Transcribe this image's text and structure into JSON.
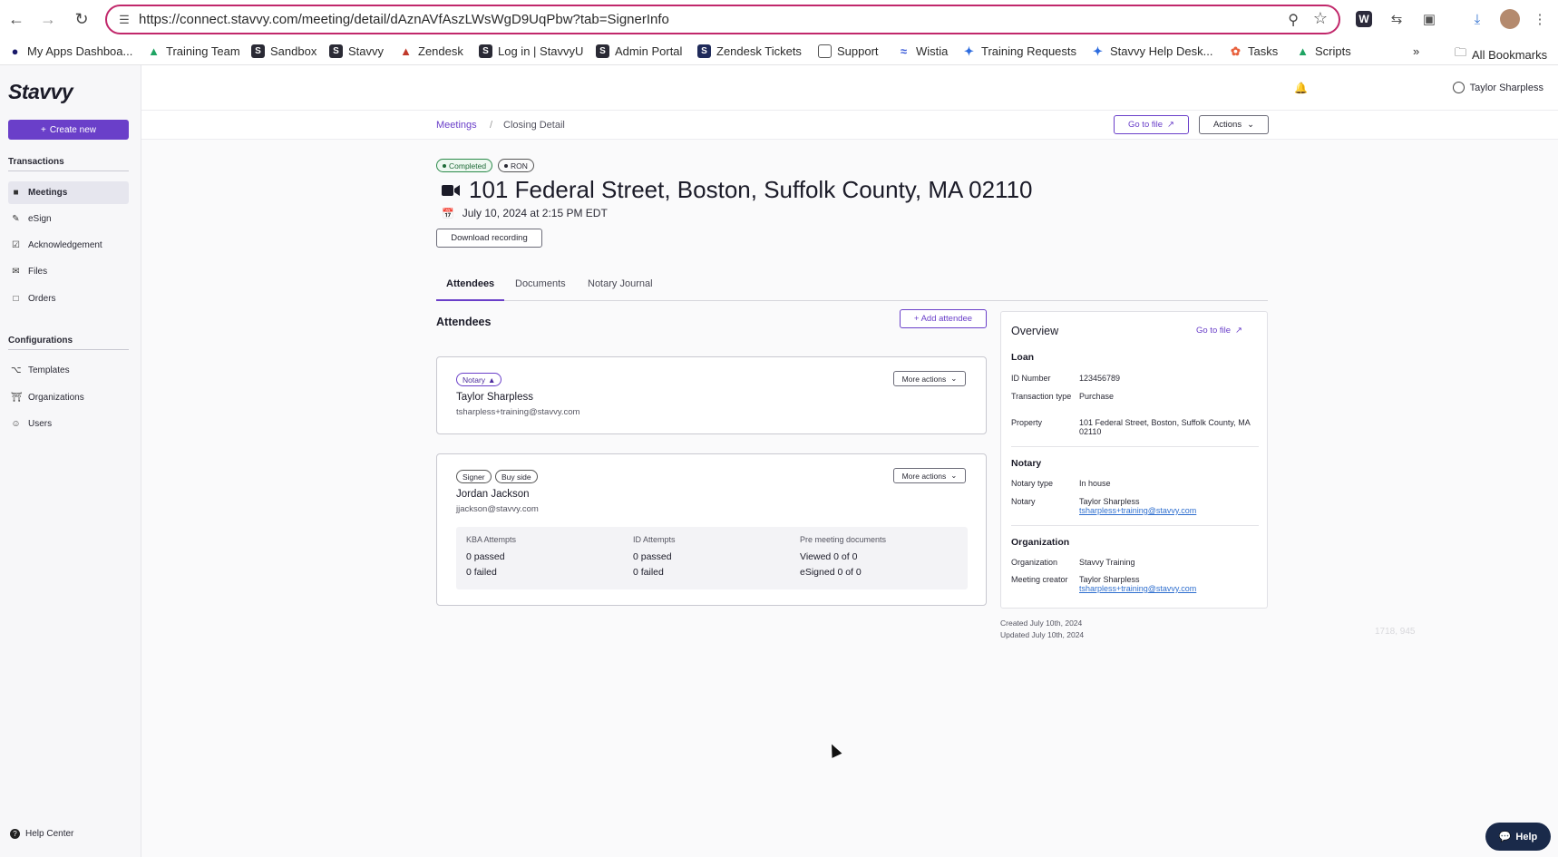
{
  "browser": {
    "url": "https://connect.stavvy.com/meeting/detail/dAznAVfAszLWsWgD9UqPbw?tab=SignerInfo",
    "bookmarks": [
      {
        "label": "My Apps Dashboa...",
        "icon": "okta-icon",
        "color": "#1a1a6a"
      },
      {
        "label": "Training Team",
        "icon": "drive-icon",
        "color": "#1fa463"
      },
      {
        "label": "Sandbox",
        "icon": "stavvy-s-icon",
        "color": "#2a2a35"
      },
      {
        "label": "Stavvy",
        "icon": "stavvy-s-icon",
        "color": "#2a2a35"
      },
      {
        "label": "Zendesk",
        "icon": "zendesk-icon",
        "color": "#c0392b"
      },
      {
        "label": "Log in | StavvyU",
        "icon": "stavvy-s-icon",
        "color": "#2a2a35"
      },
      {
        "label": "Admin Portal",
        "icon": "stavvy-s-icon",
        "color": "#2a2a35"
      },
      {
        "label": "Zendesk Tickets",
        "icon": "stavvy-s-icon",
        "color": "#1f2a5a"
      },
      {
        "label": "Support",
        "icon": "folder-icon",
        "color": "#555"
      },
      {
        "label": "Wistia",
        "icon": "wistia-icon",
        "color": "#3a5bd9"
      },
      {
        "label": "Training Requests",
        "icon": "jira-icon",
        "color": "#2d6cdf"
      },
      {
        "label": "Stavvy Help Desk...",
        "icon": "jira-icon",
        "color": "#2d6cdf"
      },
      {
        "label": "Tasks",
        "icon": "hubspot-icon",
        "color": "#e8603c"
      },
      {
        "label": "Scripts",
        "icon": "drive-icon",
        "color": "#1fa463"
      }
    ],
    "all_bookmarks": "All Bookmarks"
  },
  "sidebar": {
    "logo": "Stavvy",
    "create_new": "Create new",
    "transactions_label": "Transactions",
    "transactions": [
      {
        "label": "Meetings",
        "icon": "video-icon",
        "active": true
      },
      {
        "label": "eSign",
        "icon": "esign-icon",
        "active": false
      },
      {
        "label": "Acknowledgement",
        "icon": "checkbox-icon",
        "active": false
      },
      {
        "label": "Files",
        "icon": "mail-icon",
        "active": false
      },
      {
        "label": "Orders",
        "icon": "document-icon",
        "active": false
      }
    ],
    "configurations_label": "Configurations",
    "configurations": [
      {
        "label": "Templates",
        "icon": "template-icon"
      },
      {
        "label": "Organizations",
        "icon": "bank-icon"
      },
      {
        "label": "Users",
        "icon": "users-icon"
      }
    ],
    "help_center": "Help Center"
  },
  "header": {
    "user_name": "Taylor Sharpless"
  },
  "breadcrumb": {
    "parent": "Meetings",
    "separator": "/",
    "current": "Closing Detail"
  },
  "toolbar": {
    "go_to_file": "Go to file",
    "actions": "Actions"
  },
  "meeting": {
    "status_badge": "Completed",
    "type_badge": "RON",
    "title": "101 Federal Street, Boston, Suffolk County, MA 02110",
    "date": "July 10, 2024 at 2:15 PM EDT",
    "download_recording": "Download recording"
  },
  "tabs": [
    {
      "label": "Attendees",
      "active": true
    },
    {
      "label": "Documents",
      "active": false
    },
    {
      "label": "Notary Journal",
      "active": false
    }
  ],
  "attendees": {
    "title": "Attendees",
    "add_attendee": "+ Add attendee",
    "more_actions": "More actions",
    "notary": {
      "role": "Notary",
      "name": "Taylor Sharpless",
      "email": "tsharpless+training@stavvy.com"
    },
    "signer": {
      "role": "Signer",
      "side": "Buy side",
      "name": "Jordan Jackson",
      "email": "jjackson@stavvy.com",
      "stats": [
        {
          "heading": "KBA Attempts",
          "line1": "0 passed",
          "line2": "0 failed"
        },
        {
          "heading": "ID Attempts",
          "line1": "0 passed",
          "line2": "0 failed"
        },
        {
          "heading": "Pre meeting documents",
          "line1": "Viewed 0 of 0",
          "line2": "eSigned 0 of 0"
        }
      ]
    }
  },
  "overview": {
    "title": "Overview",
    "go_to_file": "Go to file",
    "loan_heading": "Loan",
    "id_number_label": "ID Number",
    "id_number": "123456789",
    "transaction_type_label": "Transaction type",
    "transaction_type": "Purchase",
    "property_label": "Property",
    "property": "101 Federal Street, Boston, Suffolk County, MA 02110",
    "notary_heading": "Notary",
    "notary_type_label": "Notary type",
    "notary_type": "In house",
    "notary_label": "Notary",
    "notary_name": "Taylor Sharpless",
    "notary_email": "tsharpless+training@stavvy.com",
    "organization_heading": "Organization",
    "organization_label": "Organization",
    "organization": "Stavvy Training",
    "meeting_creator_label": "Meeting creator",
    "meeting_creator_name": "Taylor Sharpless",
    "meeting_creator_email": "tsharpless+training@stavvy.com"
  },
  "meta": {
    "created": "Created July 10th, 2024",
    "updated": "Updated July 10th, 2024"
  },
  "overlay_text": "1718, 945",
  "help_button": "Help"
}
